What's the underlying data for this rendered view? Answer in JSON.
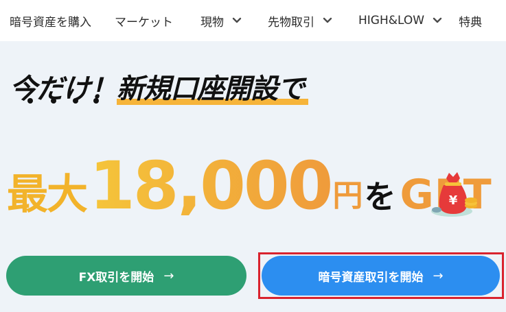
{
  "nav": {
    "items": [
      {
        "label": "暗号資産を購入",
        "dropdown": false
      },
      {
        "label": "マーケット",
        "dropdown": false
      },
      {
        "label": "現物",
        "dropdown": true
      },
      {
        "label": "先物取引",
        "dropdown": true
      },
      {
        "label": "HIGH&LOW",
        "dropdown": true
      },
      {
        "label": "特典",
        "dropdown": false
      }
    ]
  },
  "hero": {
    "line1_prefix": "今だけ！",
    "line1_highlight": "新規口座開設で",
    "line2_prefix": "最大",
    "amount": "18,000",
    "currency": "円",
    "particle": "を",
    "get": "GET"
  },
  "buttons": {
    "fx_label": "FX取引を開始",
    "crypto_label": "暗号資産取引を開始",
    "arrow": "→"
  },
  "colors": {
    "accent_gold": "#f2b32b",
    "accent_orange": "#ef9b3b",
    "fx_green": "#2e9f73",
    "crypto_blue": "#2c8ef0",
    "focus_red": "#d9232e"
  },
  "icons": {
    "chevron": "chevron-down-icon",
    "bag": "money-bag-icon"
  }
}
